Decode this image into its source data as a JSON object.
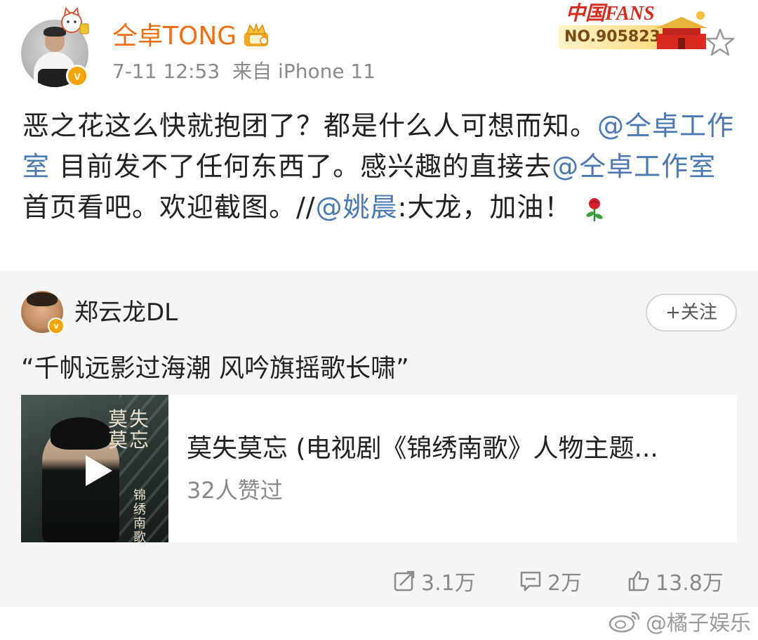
{
  "post": {
    "author": "仝卓TONG",
    "time": "7-11 12:53",
    "source": "来自 iPhone 11",
    "text_parts": [
      {
        "t": "恶之花这么快就抱团了？都是什么人可想而知。",
        "mention": false
      },
      {
        "t": "@仝卓工作室",
        "mention": true
      },
      {
        "t": " 目前发不了任何东西了。感兴趣的直接去",
        "mention": false
      },
      {
        "t": "@仝卓工作室",
        "mention": true
      },
      {
        "t": " 首页看吧。欢迎截图。//",
        "mention": false
      },
      {
        "t": "@姚晨",
        "mention": true
      },
      {
        "t": ":大龙，加油！",
        "mention": false
      }
    ]
  },
  "fans_badge": {
    "label": "中国FANS",
    "number": "NO.9058234"
  },
  "repost": {
    "author": "郑云龙DL",
    "follow_label": "+关注",
    "quote": "“千帆远影过海潮  风吟旗摇歌长啸”",
    "music": {
      "cover_title": "莫失莫忘",
      "cover_sub": "锦绣南歌",
      "title": "莫失莫忘 (电视剧《锦绣南歌》人物主题...",
      "likes": "32人赞过"
    }
  },
  "actions": {
    "repost_count": "3.1万",
    "comment_count": "2万",
    "like_count": "13.8万"
  },
  "watermark": "@橘子娱乐",
  "colors": {
    "username": "#f06f12",
    "mention": "#4b79b4",
    "meta": "#8a8a8a",
    "card_bg": "#f5f5f5",
    "verified": "#f4a300"
  },
  "icons": [
    "verified-icon",
    "crown-icon",
    "star-icon",
    "rose-icon",
    "play-icon",
    "repost-icon",
    "comment-icon",
    "like-icon",
    "weibo-logo-icon"
  ]
}
